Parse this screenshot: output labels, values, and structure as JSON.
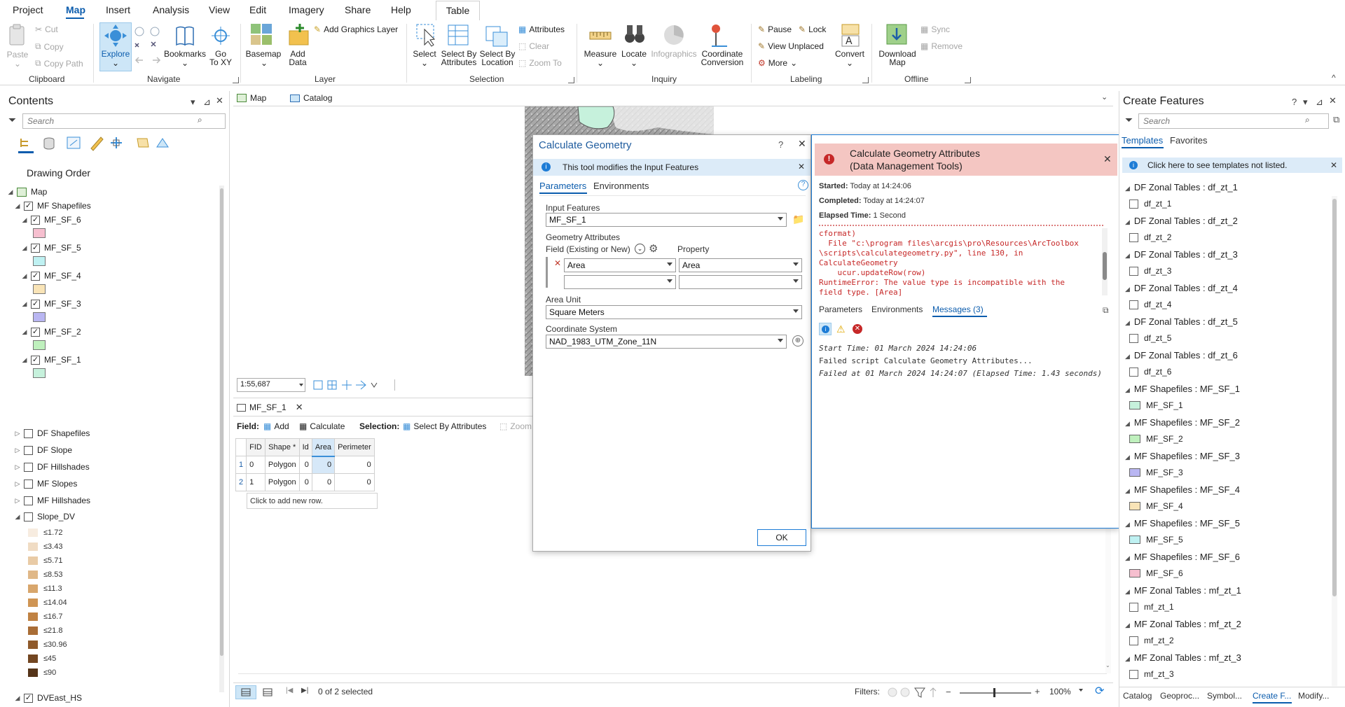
{
  "menu": {
    "items": [
      "Project",
      "Map",
      "Insert",
      "Analysis",
      "View",
      "Edit",
      "Imagery",
      "Share",
      "Help"
    ],
    "context_tab": "Table"
  },
  "ribbon": {
    "clipboard": {
      "paste": "Paste",
      "cut": "Cut",
      "copy": "Copy",
      "copy_path": "Copy Path",
      "label": "Clipboard"
    },
    "navigate": {
      "explore": "Explore",
      "bookmarks": "Bookmarks",
      "go_to": "Go To XY",
      "go": "Go",
      "to_xy": "To XY",
      "label": "Navigate"
    },
    "layer": {
      "basemap": "Basemap",
      "add": "Add",
      "data": "Data",
      "add_graphics": "Add Graphics Layer",
      "label": "Layer"
    },
    "selection": {
      "select": "Select",
      "select_by": "Select By",
      "attributes": "Attributes",
      "select_by2": "Select By",
      "location": "Location",
      "attributes_small": "Attributes",
      "clear": "Clear",
      "zoom_to": "Zoom To",
      "label": "Selection"
    },
    "inquiry": {
      "measure": "Measure",
      "locate": "Locate",
      "infographics": "Infographics",
      "coordinate": "Coordinate",
      "conversion": "Conversion",
      "label": "Inquiry"
    },
    "labeling": {
      "pause": "Pause",
      "lock": "Lock",
      "view_unplaced": "View Unplaced",
      "more": "More",
      "convert": "Convert",
      "label": "Labeling"
    },
    "offline": {
      "download": "Download",
      "map": "Map",
      "sync": "Sync",
      "remove": "Remove",
      "label": "Offline"
    }
  },
  "contents": {
    "title": "Contents",
    "search_placeholder": "Search",
    "drawing_order": "Drawing Order",
    "map_label": "Map",
    "group_mf": "MF Shapefiles",
    "layers": [
      {
        "name": "MF_SF_6",
        "color": "#f6bfcf"
      },
      {
        "name": "MF_SF_5",
        "color": "#bff1f2"
      },
      {
        "name": "MF_SF_4",
        "color": "#f9e4b7"
      },
      {
        "name": "MF_SF_3",
        "color": "#b9b6f2"
      },
      {
        "name": "MF_SF_2",
        "color": "#bff0bd"
      },
      {
        "name": "MF_SF_1",
        "color": "#c6f1dc"
      }
    ],
    "other_groups": [
      "DF Shapefiles",
      "DF Slope",
      "DF Hillshades",
      "MF Slopes",
      "MF Hillshades"
    ],
    "slope_group": "Slope_DV",
    "slope_legend": [
      {
        "label": "≤1.72",
        "color": "#f7ece0"
      },
      {
        "label": "≤3.43",
        "color": "#f0dcc4"
      },
      {
        "label": "≤5.71",
        "color": "#e9cba6"
      },
      {
        "label": "≤8.53",
        "color": "#e0b888"
      },
      {
        "label": "≤11.3",
        "color": "#d8a66c"
      },
      {
        "label": "≤14.04",
        "color": "#cf9554"
      },
      {
        "label": "≤16.7",
        "color": "#c08243"
      },
      {
        "label": "≤21.8",
        "color": "#a96d36"
      },
      {
        "label": "≤30.96",
        "color": "#8f5a2b"
      },
      {
        "label": "≤45",
        "color": "#724621"
      },
      {
        "label": "≤90",
        "color": "#553419"
      }
    ],
    "last_layer": "DVEast_HS"
  },
  "doc_tabs": {
    "map": "Map",
    "catalog": "Catalog"
  },
  "map_view": {
    "scale": "1:55,687"
  },
  "attr_table": {
    "tab": "MF_SF_1",
    "field_label": "Field:",
    "add": "Add",
    "calculate": "Calculate",
    "selection_label": "Selection:",
    "select_by_attributes": "Select By Attributes",
    "zoom": "Zoom",
    "columns": [
      "FID",
      "Shape *",
      "Id",
      "Area",
      "Perimeter"
    ],
    "rows": [
      [
        "1",
        "0",
        "Polygon",
        "0",
        "0",
        "0"
      ],
      [
        "2",
        "1",
        "Polygon",
        "0",
        "0",
        "0"
      ]
    ],
    "add_row": "Click to add new row.",
    "selected": "0 of 2 selected",
    "filters": "Filters:",
    "zoom_pct": "100%"
  },
  "calc_dialog": {
    "title": "Calculate Geometry",
    "help": "?",
    "info": "This tool modifies the Input Features",
    "tab_params": "Parameters",
    "tab_env": "Environments",
    "input_features_label": "Input Features",
    "input_features": "MF_SF_1",
    "geom_attrs_label": "Geometry Attributes",
    "field_label": "Field (Existing or New)",
    "property_label": "Property",
    "field_value": "Area",
    "property_value": "Area",
    "area_unit_label": "Area Unit",
    "area_unit": "Square Meters",
    "coord_sys_label": "Coordinate System",
    "coord_sys": "NAD_1983_UTM_Zone_11N",
    "ok": "OK"
  },
  "error_popup": {
    "title1": "Calculate Geometry Attributes",
    "title2": "(Data Management Tools)",
    "started_label": "Started:",
    "started": "Today at 14:24:06",
    "completed_label": "Completed:",
    "completed": "Today at 14:24:07",
    "elapsed_label": "Elapsed Time:",
    "elapsed": "1 Second",
    "trace": [
      "cformat)",
      "  File \"c:\\program files\\arcgis\\pro\\Resources\\ArcToolbox",
      "\\scripts\\calculategeometry.py\", line 130, in",
      "CalculateGeometry",
      "    ucur.updateRow(row)",
      "RuntimeError: The value type is incompatible with the",
      "field type. [Area]"
    ],
    "tab_params": "Parameters",
    "tab_env": "Environments",
    "tab_msgs": "Messages (3)",
    "messages": [
      "Start Time: 01 March 2024 14:24:06",
      "Failed script Calculate Geometry Attributes...",
      "Failed at 01 March 2024 14:24:07 (Elapsed Time: 1.43 seconds)"
    ]
  },
  "create_features": {
    "title": "Create Features",
    "search_placeholder": "Search",
    "tab_templates": "Templates",
    "tab_favorites": "Favorites",
    "info": "Click here to see templates not listed.",
    "groups": [
      {
        "head": "DF Zonal Tables : df_zt_1",
        "item": "df_zt_1",
        "type": "table"
      },
      {
        "head": "DF Zonal Tables : df_zt_2",
        "item": "df_zt_2",
        "type": "table"
      },
      {
        "head": "DF Zonal Tables : df_zt_3",
        "item": "df_zt_3",
        "type": "table"
      },
      {
        "head": "DF Zonal Tables : df_zt_4",
        "item": "df_zt_4",
        "type": "table"
      },
      {
        "head": "DF Zonal Tables : df_zt_5",
        "item": "df_zt_5",
        "type": "table"
      },
      {
        "head": "DF Zonal Tables : df_zt_6",
        "item": "df_zt_6",
        "type": "table"
      },
      {
        "head": "MF Shapefiles : MF_SF_1",
        "item": "MF_SF_1",
        "type": "poly",
        "color": "#c6f1dc"
      },
      {
        "head": "MF Shapefiles : MF_SF_2",
        "item": "MF_SF_2",
        "type": "poly",
        "color": "#bff0bd"
      },
      {
        "head": "MF Shapefiles : MF_SF_3",
        "item": "MF_SF_3",
        "type": "poly",
        "color": "#b9b6f2"
      },
      {
        "head": "MF Shapefiles : MF_SF_4",
        "item": "MF_SF_4",
        "type": "poly",
        "color": "#f9e4b7"
      },
      {
        "head": "MF Shapefiles : MF_SF_5",
        "item": "MF_SF_5",
        "type": "poly",
        "color": "#bff1f2"
      },
      {
        "head": "MF Shapefiles : MF_SF_6",
        "item": "MF_SF_6",
        "type": "poly",
        "color": "#f6bfcf"
      },
      {
        "head": "MF Zonal Tables : mf_zt_1",
        "item": "mf_zt_1",
        "type": "table"
      },
      {
        "head": "MF Zonal Tables : mf_zt_2",
        "item": "mf_zt_2",
        "type": "table"
      },
      {
        "head": "MF Zonal Tables : mf_zt_3",
        "item": "mf_zt_3",
        "type": "table"
      }
    ]
  },
  "bottom_tabs": [
    "Catalog",
    "Geoproc...",
    "Symbol...",
    "Create F...",
    "Modify..."
  ],
  "colors": {
    "accent": "#0b5cad",
    "error_bg": "#f4c6c2",
    "info_bg": "#dcebf8",
    "explore_bg": "#cde6f7"
  }
}
